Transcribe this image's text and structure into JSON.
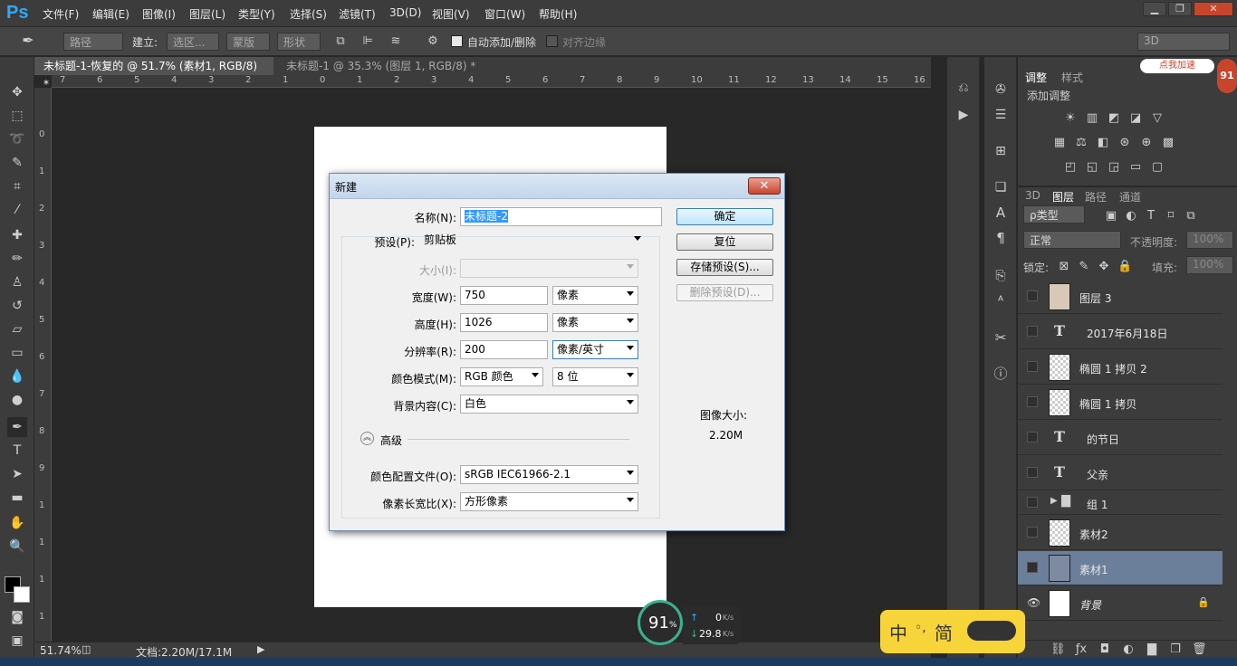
{
  "menubar": {
    "logo": "Ps",
    "items": [
      "文件(F)",
      "编辑(E)",
      "图像(I)",
      "图层(L)",
      "类型(Y)",
      "选择(S)",
      "滤镜(T)",
      "3D(D)",
      "视图(V)",
      "窗口(W)",
      "帮助(H)"
    ]
  },
  "options": {
    "mode": "路径",
    "build_label": "建立:",
    "selection": "选区...",
    "mask": "蒙版",
    "shape": "形状",
    "auto_add_delete": "自动添加/删除",
    "align_edges": "对齐边缘",
    "workspace": "3D"
  },
  "tabs": [
    {
      "label": "未标题-1-恢复的 @ 51.7% (素材1, RGB/8) *",
      "close": "×"
    },
    {
      "label": "未标题-1 @ 35.3% (图层 1, RGB/8) *",
      "close": "×"
    }
  ],
  "ruler_h": [
    "7",
    "6",
    "5",
    "4",
    "3",
    "2",
    "1",
    "0",
    "1",
    "2",
    "3",
    "4",
    "5",
    "6",
    "7",
    "8",
    "9",
    "10",
    "11",
    "12",
    "13",
    "14",
    "15",
    "16"
  ],
  "ruler_v": [
    "0",
    "1",
    "2",
    "3",
    "4",
    "5",
    "6",
    "7",
    "8",
    "9",
    "1",
    "1",
    "1",
    "1"
  ],
  "status": {
    "zoom": "51.74%",
    "doc": "文档:2.20M/17.1M"
  },
  "dialog": {
    "title": "新建",
    "name_label": "名称(N):",
    "name_value": "未标题-2",
    "preset_label": "预设(P):",
    "preset_value": "剪贴板",
    "size_label": "大小(I):",
    "width_label": "宽度(W):",
    "width_value": "750",
    "width_unit": "像素",
    "height_label": "高度(H):",
    "height_value": "1026",
    "height_unit": "像素",
    "resolution_label": "分辨率(R):",
    "resolution_value": "200",
    "resolution_unit": "像素/英寸",
    "color_mode_label": "颜色模式(M):",
    "color_mode_value": "RGB 颜色",
    "bit_depth": "8 位",
    "background_label": "背景内容(C):",
    "background_value": "白色",
    "advanced": "高级",
    "profile_label": "颜色配置文件(O):",
    "profile_value": "sRGB IEC61966-2.1",
    "pixel_aspect_label": "像素长宽比(X):",
    "pixel_aspect_value": "方形像素",
    "ok": "确定",
    "reset": "复位",
    "save_preset": "存储预设(S)...",
    "delete_preset": "删除预设(D)...",
    "image_size_label": "图像大小:",
    "image_size_value": "2.20M",
    "close": "✕"
  },
  "adjust": {
    "tab_adjust": "调整",
    "tab_style": "样式",
    "add_adjust": "添加调整",
    "promo": "点我加速",
    "promo_num": "91"
  },
  "layers": {
    "tab_3d": "3D",
    "tab_layers": "图层",
    "tab_paths": "路径",
    "tab_channels": "通道",
    "filter": "ρ类型",
    "blend": "正常",
    "opacity_label": "不透明度:",
    "opacity": "100%",
    "lock_label": "锁定:",
    "fill_label": "填充:",
    "fill": "100%",
    "items": [
      {
        "name": "图层 3",
        "kind": "image"
      },
      {
        "name": "2017年6月18日",
        "kind": "text"
      },
      {
        "name": "椭圆 1 拷贝 2",
        "kind": "transparent"
      },
      {
        "name": "椭圆 1 拷贝",
        "kind": "transparent"
      },
      {
        "name": "的节日",
        "kind": "text"
      },
      {
        "name": "父亲",
        "kind": "text"
      },
      {
        "name": "组 1",
        "kind": "group"
      },
      {
        "name": "素材2",
        "kind": "smart"
      },
      {
        "name": "素材1",
        "kind": "smart",
        "selected": true
      },
      {
        "name": "背景",
        "kind": "white",
        "visible": true
      }
    ]
  },
  "meter": {
    "percent": "91",
    "unit": "%",
    "up": "0",
    "down": "29.8",
    "speed_unit": "K/s"
  },
  "ime": {
    "zh": "中",
    "simp": "简",
    "dots": "◦,"
  },
  "colors": {
    "accent": "#31a8ff",
    "selection": "#6b7e9a",
    "dialog_title": "#c3d5ea"
  }
}
